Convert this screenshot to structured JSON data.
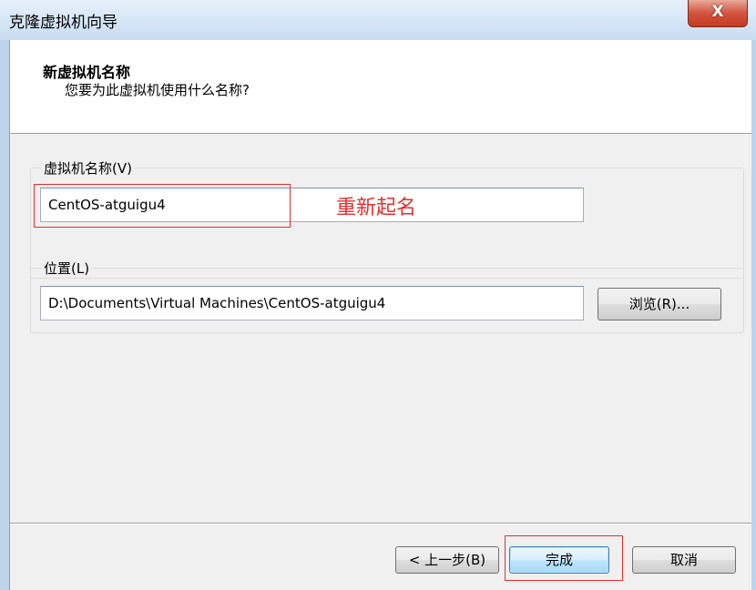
{
  "window": {
    "title": "克隆虚拟机向导",
    "close_label": "X"
  },
  "header": {
    "title": "新虚拟机名称",
    "subtitle": "您要为此虚拟机使用什么名称?"
  },
  "name_group": {
    "legend": "虚拟机名称(V)",
    "value": "CentOS-atguigu4",
    "annotation": "重新起名"
  },
  "location_group": {
    "legend": "位置(L)",
    "value": "D:\\Documents\\Virtual Machines\\CentOS-atguigu4",
    "browse_label": "浏览(R)..."
  },
  "footer": {
    "back_label": "< 上一步(B)",
    "finish_label": "完成",
    "cancel_label": "取消"
  },
  "colors": {
    "highlight": "#e03030",
    "title_bar": "#d3e4f6",
    "close_button": "#c23b22"
  }
}
